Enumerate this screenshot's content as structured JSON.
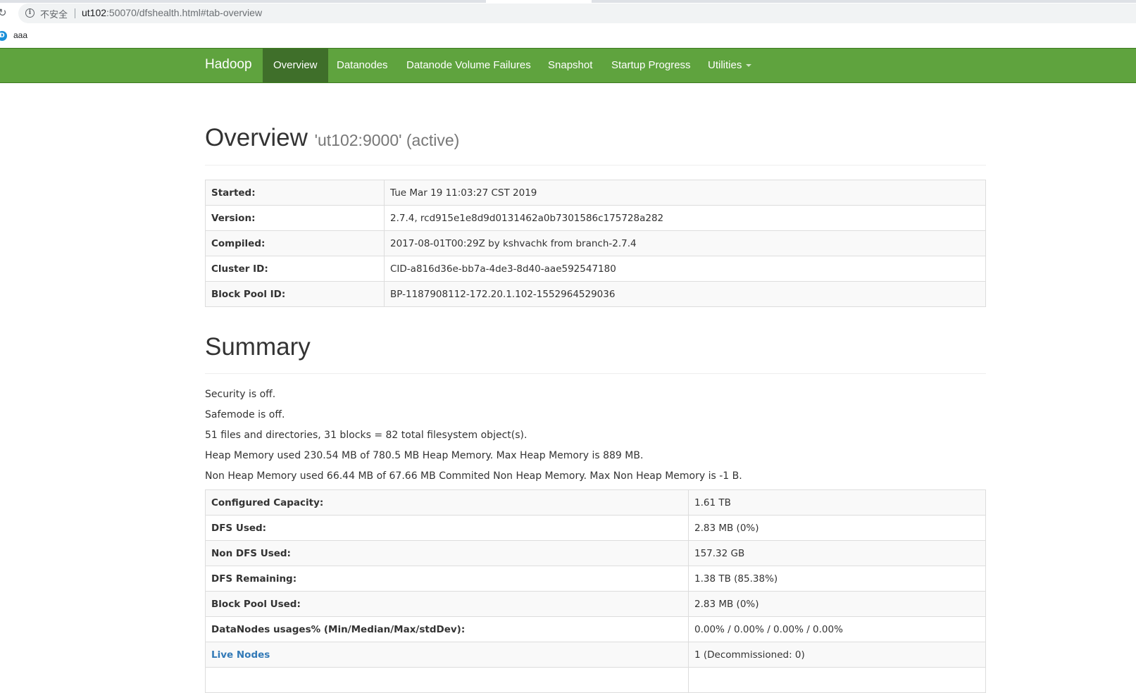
{
  "browser": {
    "security_label": "不安全",
    "url_host": "ut102",
    "url_rest": ":50070/dfshealth.html#tab-overview",
    "bookmark_icon_letter": "D",
    "bookmark_label": "aaa"
  },
  "navbar": {
    "brand": "Hadoop",
    "items": [
      {
        "label": "Overview",
        "active": true
      },
      {
        "label": "Datanodes"
      },
      {
        "label": "Datanode Volume Failures"
      },
      {
        "label": "Snapshot"
      },
      {
        "label": "Startup Progress"
      },
      {
        "label": "Utilities"
      }
    ],
    "colors": {
      "bar": "#5fa33e",
      "active": "#3f6f2a"
    }
  },
  "overview": {
    "title": "Overview",
    "subtitle": "'ut102:9000' (active)",
    "rows": [
      {
        "key": "Started:",
        "value": "Tue Mar 19 11:03:27 CST 2019"
      },
      {
        "key": "Version:",
        "value": "2.7.4, rcd915e1e8d9d0131462a0b7301586c175728a282"
      },
      {
        "key": "Compiled:",
        "value": "2017-08-01T00:29Z by kshvachk from branch-2.7.4"
      },
      {
        "key": "Cluster ID:",
        "value": "CID-a816d36e-bb7a-4de3-8d40-aae592547180"
      },
      {
        "key": "Block Pool ID:",
        "value": "BP-1187908112-172.20.1.102-1552964529036"
      }
    ]
  },
  "summary": {
    "title": "Summary",
    "lines": [
      "Security is off.",
      "Safemode is off.",
      "51 files and directories, 31 blocks = 82 total filesystem object(s).",
      "Heap Memory used 230.54 MB of 780.5 MB Heap Memory. Max Heap Memory is 889 MB.",
      "Non Heap Memory used 66.44 MB of 67.66 MB Commited Non Heap Memory. Max Non Heap Memory is -1 B."
    ],
    "rows": [
      {
        "key": "Configured Capacity:",
        "value": "1.61 TB"
      },
      {
        "key": "DFS Used:",
        "value": "2.83 MB (0%)"
      },
      {
        "key": "Non DFS Used:",
        "value": "157.32 GB"
      },
      {
        "key": "DFS Remaining:",
        "value": "1.38 TB (85.38%)"
      },
      {
        "key": "Block Pool Used:",
        "value": "2.83 MB (0%)"
      },
      {
        "key": "DataNodes usages% (Min/Median/Max/stdDev):",
        "value": "0.00% / 0.00% / 0.00% / 0.00%"
      },
      {
        "key": "Live Nodes",
        "value": "1 (Decommissioned: 0)",
        "link": true
      }
    ]
  }
}
